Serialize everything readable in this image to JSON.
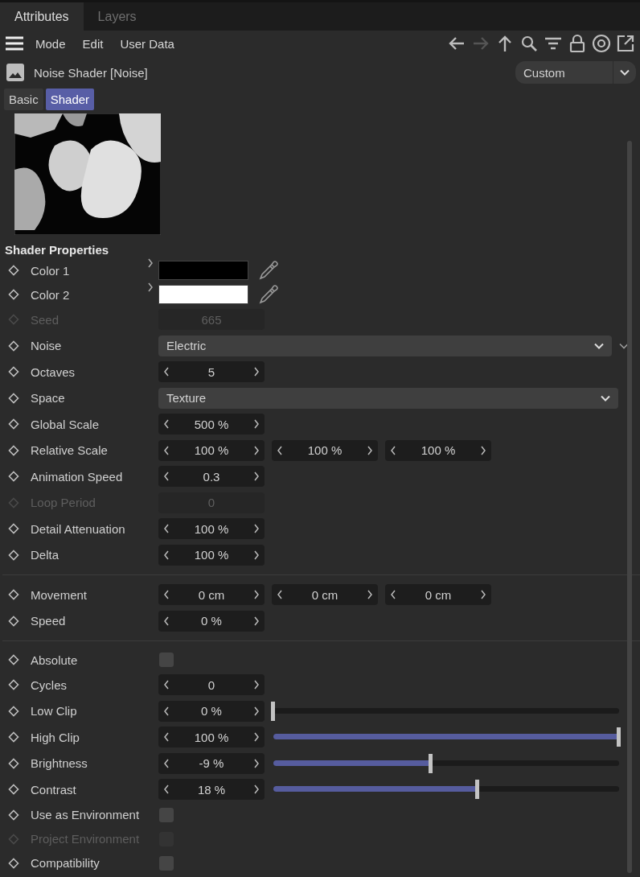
{
  "panel_tabs": [
    {
      "label": "Attributes",
      "selected": true
    },
    {
      "label": "Layers",
      "selected": false
    }
  ],
  "menu": [
    "Mode",
    "Edit",
    "User Data"
  ],
  "object": {
    "name": "Noise Shader [Noise]",
    "preset": "Custom"
  },
  "tabs": [
    {
      "label": "Basic",
      "selected": false
    },
    {
      "label": "Shader",
      "selected": true
    }
  ],
  "section_title": "Shader Properties",
  "groups": [
    [
      {
        "kind": "color",
        "label": "Color 1",
        "color": "#000000",
        "disabled": false
      },
      {
        "kind": "color",
        "label": "Color 2",
        "color": "#ffffff",
        "disabled": false
      },
      {
        "kind": "number",
        "label": "Seed",
        "value": "665",
        "disabled": true
      },
      {
        "kind": "dropdown",
        "label": "Noise",
        "value": "Electric",
        "expanded": false,
        "disabled": false
      },
      {
        "kind": "number",
        "label": "Octaves",
        "value": "5",
        "disabled": false
      },
      {
        "kind": "dropdown",
        "label": "Space",
        "value": "Texture",
        "disabled": false
      },
      {
        "kind": "number",
        "label": "Global Scale",
        "value": "500 %",
        "disabled": false
      },
      {
        "kind": "vector",
        "label": "Relative Scale",
        "values": [
          "100 %",
          "100 %",
          "100 %"
        ],
        "disabled": false
      },
      {
        "kind": "number",
        "label": "Animation Speed",
        "value": "0.3",
        "disabled": false
      },
      {
        "kind": "number",
        "label": "Loop Period",
        "value": "0",
        "disabled": true
      },
      {
        "kind": "number",
        "label": "Detail Attenuation",
        "value": "100 %",
        "disabled": false
      },
      {
        "kind": "number",
        "label": "Delta",
        "value": "100 %",
        "disabled": false
      }
    ],
    [
      {
        "kind": "vector",
        "label": "Movement",
        "values": [
          "0 cm",
          "0 cm",
          "0 cm"
        ],
        "disabled": false
      },
      {
        "kind": "number",
        "label": "Speed",
        "value": "0 %",
        "disabled": false
      }
    ],
    [
      {
        "kind": "checkbox",
        "label": "Absolute",
        "checked": false,
        "disabled": false
      },
      {
        "kind": "number",
        "label": "Cycles",
        "value": "0",
        "disabled": false
      },
      {
        "kind": "slider",
        "label": "Low Clip",
        "value": "0 %",
        "level": 0,
        "disabled": false
      },
      {
        "kind": "slider",
        "label": "High Clip",
        "value": "100 %",
        "level": 1,
        "disabled": false
      },
      {
        "kind": "slider",
        "label": "Brightness",
        "value": "-9 %",
        "level": 0.455,
        "disabled": false
      },
      {
        "kind": "slider",
        "label": "Contrast",
        "value": "18 %",
        "level": 0.59,
        "disabled": false
      },
      {
        "kind": "checkbox",
        "label": "Use as Environment",
        "checked": false,
        "disabled": false
      },
      {
        "kind": "checkbox",
        "label": "Project Environment",
        "checked": false,
        "disabled": true
      },
      {
        "kind": "checkbox",
        "label": "Compatibility",
        "checked": false,
        "disabled": false
      }
    ]
  ]
}
